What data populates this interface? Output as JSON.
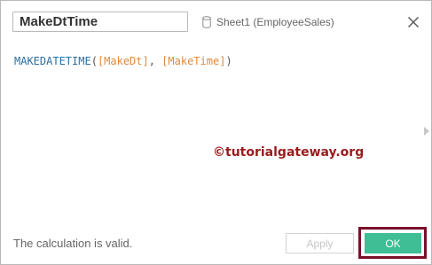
{
  "calc_name": "MakeDtTime",
  "datasource": {
    "label": "Sheet1 (EmployeeSales)",
    "icon": "database-icon"
  },
  "close_icon": "close-icon",
  "formula": {
    "function_name": "MAKEDATETIME",
    "open_paren": "(",
    "arg1": "[MakeDt]",
    "separator": ", ",
    "arg2": "[MakeTime]",
    "close_paren": ")"
  },
  "watermark": "©tutorialgateway.org",
  "status_text": "The calculation is valid.",
  "buttons": {
    "apply_label": "Apply",
    "ok_label": "OK"
  },
  "colors": {
    "function": "#2d6e9e",
    "field": "#e08a3c",
    "ok_button": "#3fbd94",
    "highlight": "#7a0f2a",
    "watermark": "#9a1c1c"
  }
}
